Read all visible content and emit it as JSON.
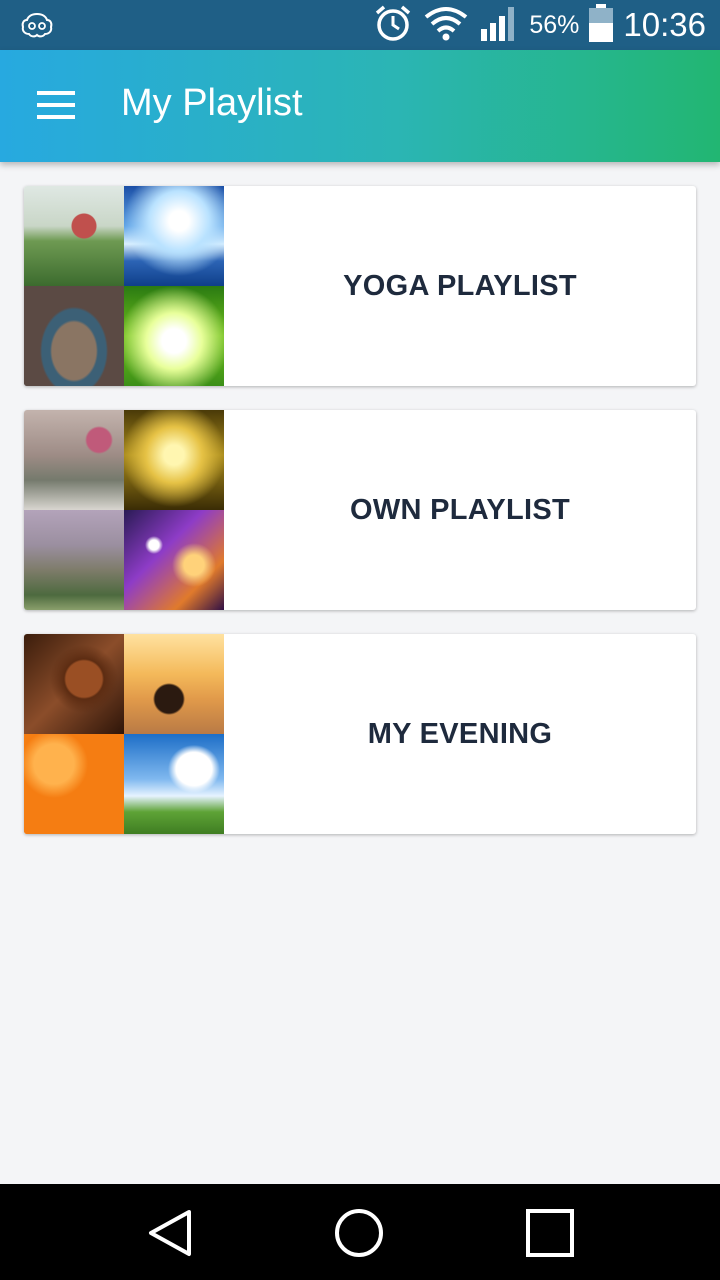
{
  "status_bar": {
    "battery_percent": "56%",
    "time": "10:36",
    "icons": [
      "brain-icon",
      "alarm-icon",
      "wifi-icon",
      "signal-icon",
      "battery-icon"
    ]
  },
  "app_bar": {
    "menu_icon": "hamburger-menu-icon",
    "title": "My Playlist"
  },
  "playlists": [
    {
      "title": "YOGA PLAYLIST"
    },
    {
      "title": "OWN PLAYLIST"
    },
    {
      "title": "MY EVENING"
    }
  ],
  "nav_bar": {
    "icons": [
      "back-icon",
      "home-icon",
      "recent-apps-icon"
    ]
  },
  "colors": {
    "status_bar": "#1f5f86",
    "app_bar_start": "#27a9e0",
    "app_bar_end": "#22b672",
    "card_title": "#1e2a3d",
    "background": "#f4f5f7"
  }
}
